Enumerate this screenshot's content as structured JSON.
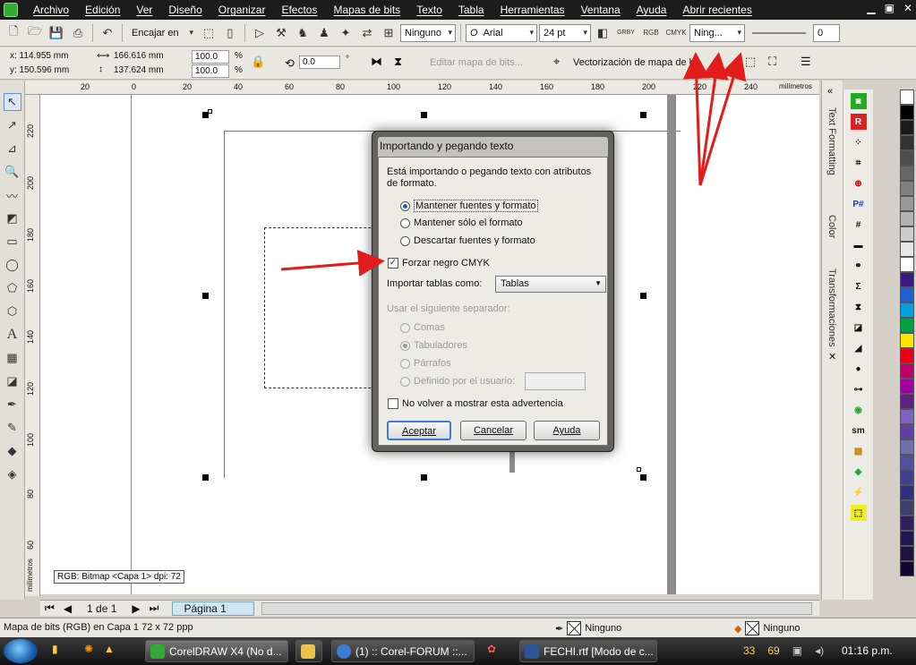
{
  "menu": {
    "items": [
      "Archivo",
      "Edición",
      "Ver",
      "Diseño",
      "Organizar",
      "Efectos",
      "Mapas de bits",
      "Texto",
      "Tabla",
      "Herramientas",
      "Ventana",
      "Ayuda",
      "Abrir recientes"
    ]
  },
  "toolbar": {
    "fit_label": "Encajar en",
    "snap_value": "Ninguno",
    "font_name": "Arial",
    "font_size": "24 pt",
    "outline_value": "Ning...",
    "slider_value": "0",
    "color_buttons": [
      "GRBY",
      "RGB",
      "CMYK"
    ]
  },
  "props": {
    "x": "x: 114.955 mm",
    "y": "y: 150.596 mm",
    "w": "166.616 mm",
    "h": "137.624 mm",
    "scale_x": "100.0",
    "scale_y": "100.0",
    "pct": "%",
    "rotation": "0.0",
    "degree": "°",
    "edit_bitmap": "Editar mapa de bits...",
    "trace_bitmap": "Vectorización de mapa de bits"
  },
  "ruler": {
    "units": "milímetros",
    "top_ticks": [
      "20",
      "0",
      "20",
      "40",
      "60",
      "80",
      "100",
      "120",
      "140",
      "160",
      "180",
      "200",
      "220",
      "240"
    ],
    "left_ticks": [
      "220",
      "200",
      "180",
      "160",
      "140",
      "120",
      "100",
      "80",
      "60"
    ],
    "left_units": "milímetros"
  },
  "canvas": {
    "status_tag": "RGB: Bitmap <Capa 1> dpi: 72"
  },
  "dockers": {
    "text_formatting": "Text Formatting",
    "color": "Color",
    "transformaciones": "Transformaciones"
  },
  "dialog": {
    "title": "Importando y pegando texto",
    "description": "Está importando o pegando texto con atributos de formato.",
    "options": [
      {
        "label": "Mantener fuentes y formato",
        "selected": true
      },
      {
        "label": "Mantener sólo el formato",
        "selected": false
      },
      {
        "label": "Descartar fuentes y formato",
        "selected": false
      }
    ],
    "force_black": "Forzar negro CMYK",
    "import_tables_label": "Importar tablas como:",
    "import_tables_value": "Tablas",
    "separator_label": "Usar el siguiente separador:",
    "separators": [
      {
        "label": "Comas",
        "selected": false
      },
      {
        "label": "Tabuladores",
        "selected": true
      },
      {
        "label": "Párrafos",
        "selected": false
      },
      {
        "label": "Definido por el usuario:",
        "selected": false
      }
    ],
    "dont_show": "No volver a mostrar esta advertencia",
    "accept": "Aceptar",
    "cancel": "Cancelar",
    "help": "Ayuda"
  },
  "pagebar": {
    "page_of": "1 de 1",
    "page_tab": "Página 1"
  },
  "status": {
    "left": "Mapa de bits (RGB) en Capa 1 72 x 72 ppp",
    "fill": "Ninguno",
    "outline": "Ninguno"
  },
  "taskbar": {
    "items": [
      "CorelDRAW X4 (No d...",
      "(1) :: Corel-FORUM ::...",
      "FECHI.rtf [Modo de c..."
    ],
    "tray_nums": [
      "33",
      "69"
    ],
    "clock": "01:16 p.m."
  },
  "palette_colors": [
    "#ffffff",
    "#000000",
    "#1a1a1a",
    "#333333",
    "#4d4d4d",
    "#666666",
    "#808080",
    "#999999",
    "#b3b3b3",
    "#cccccc",
    "#e6e6e6",
    "#ffffff",
    "#3a1a80",
    "#1f60d0",
    "#00a0e0",
    "#00a040",
    "#ffe600",
    "#e6001a",
    "#c0006a",
    "#a000a0",
    "#602080",
    "#8060c0",
    "#6040a0",
    "#7070b0",
    "#5050a0",
    "#404090",
    "#303080",
    "#404070",
    "#302060",
    "#201850",
    "#201040",
    "#100830"
  ]
}
